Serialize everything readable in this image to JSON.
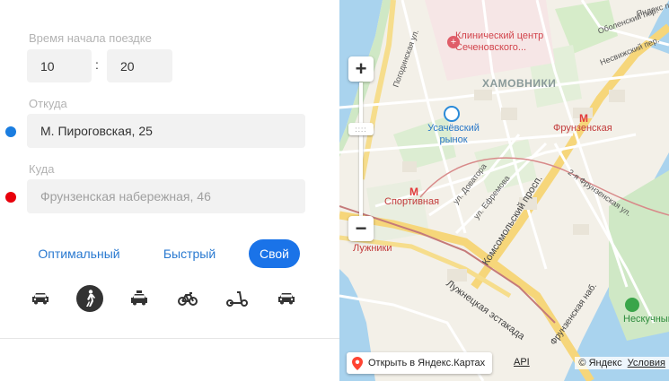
{
  "form": {
    "time_label": "Время начала поездке",
    "hour": "10",
    "minute": "20",
    "time_separator": ":",
    "from_label": "Откуда",
    "from_value": "М. Пироговская, 25",
    "to_label": "Куда",
    "to_placeholder": "Фрунзенская набережная, 46"
  },
  "modes": [
    {
      "label": "Оптимальный"
    },
    {
      "label": "Быстрый"
    },
    {
      "label": "Свой"
    }
  ],
  "active_mode": "Свой",
  "transport": [
    {
      "icon": "car-icon"
    },
    {
      "icon": "pedestrian-icon",
      "active": true
    },
    {
      "icon": "taxi-icon"
    },
    {
      "icon": "bicycle-icon"
    },
    {
      "icon": "scooter-icon"
    },
    {
      "icon": "car-icon"
    }
  ],
  "colors": {
    "from_dot": "#1a7de0",
    "to_dot": "#e8000b",
    "active_mode_bg": "#1a73e8",
    "mode_text": "#2979d0",
    "metro": "#e23b3b"
  },
  "map": {
    "district": "ХАМОВНИКИ",
    "poi_clinic": "Клинический центр Сеченовского...",
    "poi_market": "Усачёвский рынок",
    "metro_frunzenskaya": "Фрунзенская",
    "metro_sportivnaya": "Спортивная",
    "metro_luzhniki": "Лужники",
    "park_neskuchny": "Нескучный",
    "streets": {
      "pogodinskaya": "Погодинская ул.",
      "komsomolsky": "Комсомольский просп.",
      "luzhnetskaya": "Лужнецкая эстакада",
      "dovatora": "ул. Доватора",
      "efremova": "ул. Ефремова",
      "frunzenskaya_2": "2-я Фрунзенская ул.",
      "oboleński": "Оболенский пер.",
      "nesvizhsky": "Несвижский пер.",
      "frunzenskaya_nab": "Фрунзенская наб.",
      "yandex_per": "Яндекс пер."
    },
    "open_in_yandex": "Открыть в Яндекс.Картах",
    "api": "API",
    "copyright": "© Яндекс",
    "terms": "Условия"
  }
}
